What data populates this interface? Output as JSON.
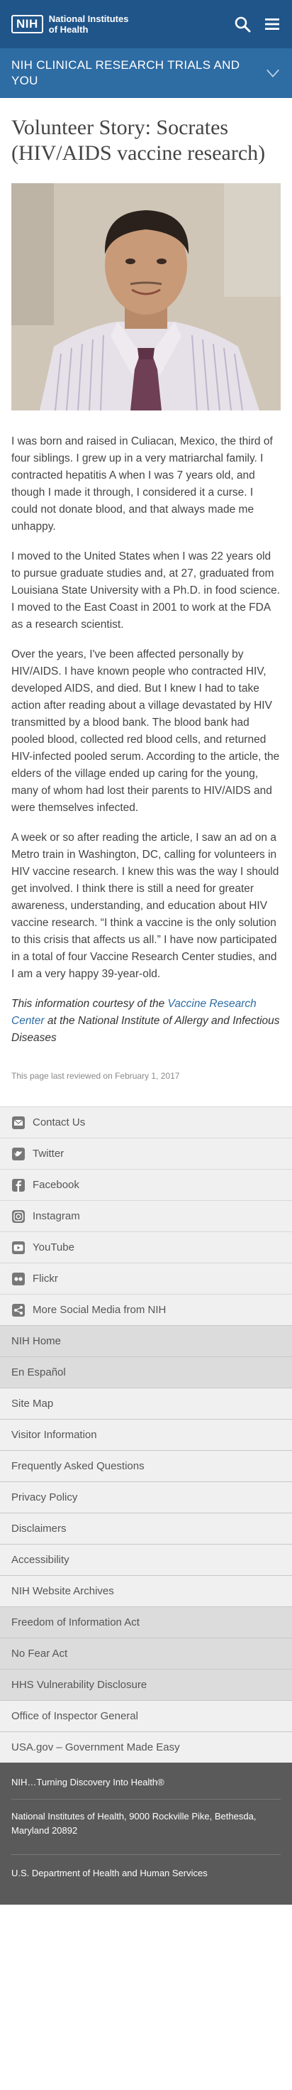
{
  "header": {
    "logo_abbrev": "NIH",
    "logo_line1": "National Institutes",
    "logo_line2": "of Health",
    "search_icon": "search-icon",
    "menu_icon": "hamburger-menu-icon",
    "colors": {
      "header_bg": "#20558a",
      "banner_bg": "#2e6ca4"
    }
  },
  "banner": {
    "title": "NIH CLINICAL RESEARCH TRIALS AND YOU",
    "icon": "chevron-down-icon"
  },
  "main": {
    "title": "Volunteer Story: Socrates (HIV/AIDS vaccine research)",
    "paragraphs": [
      "I was born and raised in Culiacan, Mexico, the third of four siblings. I grew up in a very matriarchal family. I contracted hepatitis A when I was 7 years old, and though I made it through, I considered it a curse. I could not donate blood, and that always made me unhappy.",
      "I moved to the United States when I was 22 years old to pursue graduate studies and, at 27, graduated from Louisiana State University with a Ph.D. in food science. I moved to the East Coast in 2001 to work at the FDA as a research scientist.",
      "Over the years, I've been affected personally by HIV/AIDS. I have known people who contracted HIV, developed AIDS, and died. But I knew I had to take action after reading about a village devastated by HIV transmitted by a blood bank. The blood bank had pooled blood, collected red blood cells, and returned HIV-infected pooled serum. According to the article, the elders of the village ended up caring for the young, many of whom had lost their parents to HIV/AIDS and were themselves infected.",
      "A week or so after reading the article, I saw an ad on a Metro train in Washington, DC, calling for volunteers in HIV vaccine research. I knew this was the way I should get involved. I think there is still a need for greater awareness, understanding, and education about HIV vaccine research. “I think a vaccine is the only solution to this crisis that affects us all.” I have now participated in a total of four Vaccine Research Center studies, and I am a very happy 39-year-old."
    ],
    "credit_prefix": "This information courtesy of the ",
    "credit_link": "Vaccine Research Center",
    "credit_suffix": " at the National Institute of Allergy and Infectious Diseases",
    "reviewed": "This page last reviewed on February 1, 2017"
  },
  "social": [
    {
      "label": "Contact Us",
      "icon": "mail-icon"
    },
    {
      "label": "Twitter",
      "icon": "twitter-icon"
    },
    {
      "label": "Facebook",
      "icon": "facebook-icon"
    },
    {
      "label": "Instagram",
      "icon": "instagram-icon"
    },
    {
      "label": "YouTube",
      "icon": "youtube-icon"
    },
    {
      "label": "Flickr",
      "icon": "flickr-icon"
    },
    {
      "label": "More Social Media from NIH",
      "icon": "share-icon"
    }
  ],
  "links": {
    "group_a": [
      "NIH Home",
      "En Español"
    ],
    "group_b": [
      "Site Map",
      "Visitor Information",
      "Frequently Asked Questions",
      "Privacy Policy",
      "Disclaimers",
      "Accessibility",
      "NIH Website Archives"
    ],
    "group_c": [
      "Freedom of Information Act",
      "No Fear Act",
      "HHS Vulnerability Disclosure"
    ],
    "group_d": [
      "Office of Inspector General",
      "USA.gov – Government Made Easy"
    ]
  },
  "footer": {
    "tagline": "NIH…Turning Discovery Into Health®",
    "address": "National Institutes of Health, 9000 Rockville Pike, Bethesda, Maryland 20892",
    "hhs": "U.S. Department of Health and Human Services"
  }
}
